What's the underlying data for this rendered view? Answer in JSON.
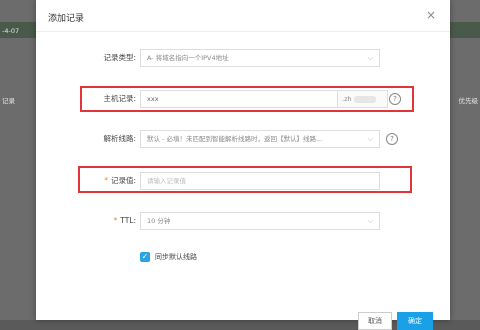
{
  "background": {
    "left_strip_text": "-4-07",
    "left_row_text": "记录",
    "right_row_text": "优先级"
  },
  "modal": {
    "title": "添加记录",
    "close_glyph": "×"
  },
  "form": {
    "record_type": {
      "label": "记录类型:",
      "value": "A- 将域名指向一个IPV4地址",
      "chevron": "⌵"
    },
    "host_record": {
      "label": "主机记录:",
      "value": "xxx",
      "suffix": ".zh",
      "help": "?"
    },
    "line": {
      "label": "解析线路:",
      "value": "默认 - 必填！未匹配到智能解析线路时，返回【默认】线路...",
      "chevron": "⌵",
      "help": "?"
    },
    "record_value": {
      "required_mark": "*",
      "label": "记录值:",
      "placeholder": "请输入记录值"
    },
    "ttl": {
      "required_mark": "*",
      "label": "TTL:",
      "value": "10 分钟",
      "chevron": "⌵"
    },
    "sync_default": {
      "checked_glyph": "✓",
      "label": "同步默认线路"
    }
  },
  "footer": {
    "cancel_label": "取消",
    "ok_label": "确定"
  },
  "colors": {
    "highlight": "#e0363b",
    "primary": "#19a0e6",
    "required": "#e98a2c"
  }
}
